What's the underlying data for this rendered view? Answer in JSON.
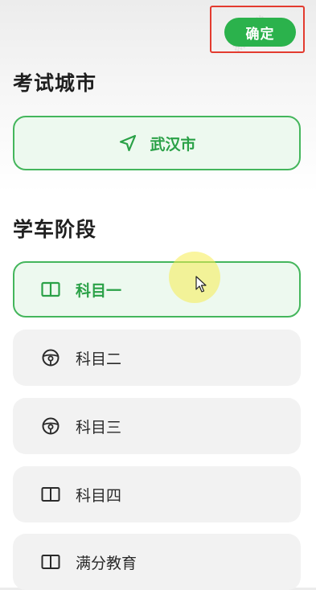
{
  "header": {
    "confirm_label": "确定"
  },
  "city_section": {
    "title": "考试城市",
    "selected_city": "武汉市",
    "icon": "location-arrow-icon"
  },
  "stage_section": {
    "title": "学车阶段",
    "items": [
      {
        "label": "科目一",
        "icon": "book-icon",
        "selected": true
      },
      {
        "label": "科目二",
        "icon": "steering-wheel-icon",
        "selected": false
      },
      {
        "label": "科目三",
        "icon": "steering-wheel-icon",
        "selected": false
      },
      {
        "label": "科目四",
        "icon": "book-icon",
        "selected": false
      },
      {
        "label": "满分教育",
        "icon": "book-icon",
        "selected": false
      }
    ]
  },
  "colors": {
    "accent": "#2bb24c",
    "accent_border": "#44b65c",
    "selected_bg": "#edf9ef",
    "card_bg": "#f2f2f2",
    "highlight_red": "#e33b2f"
  }
}
